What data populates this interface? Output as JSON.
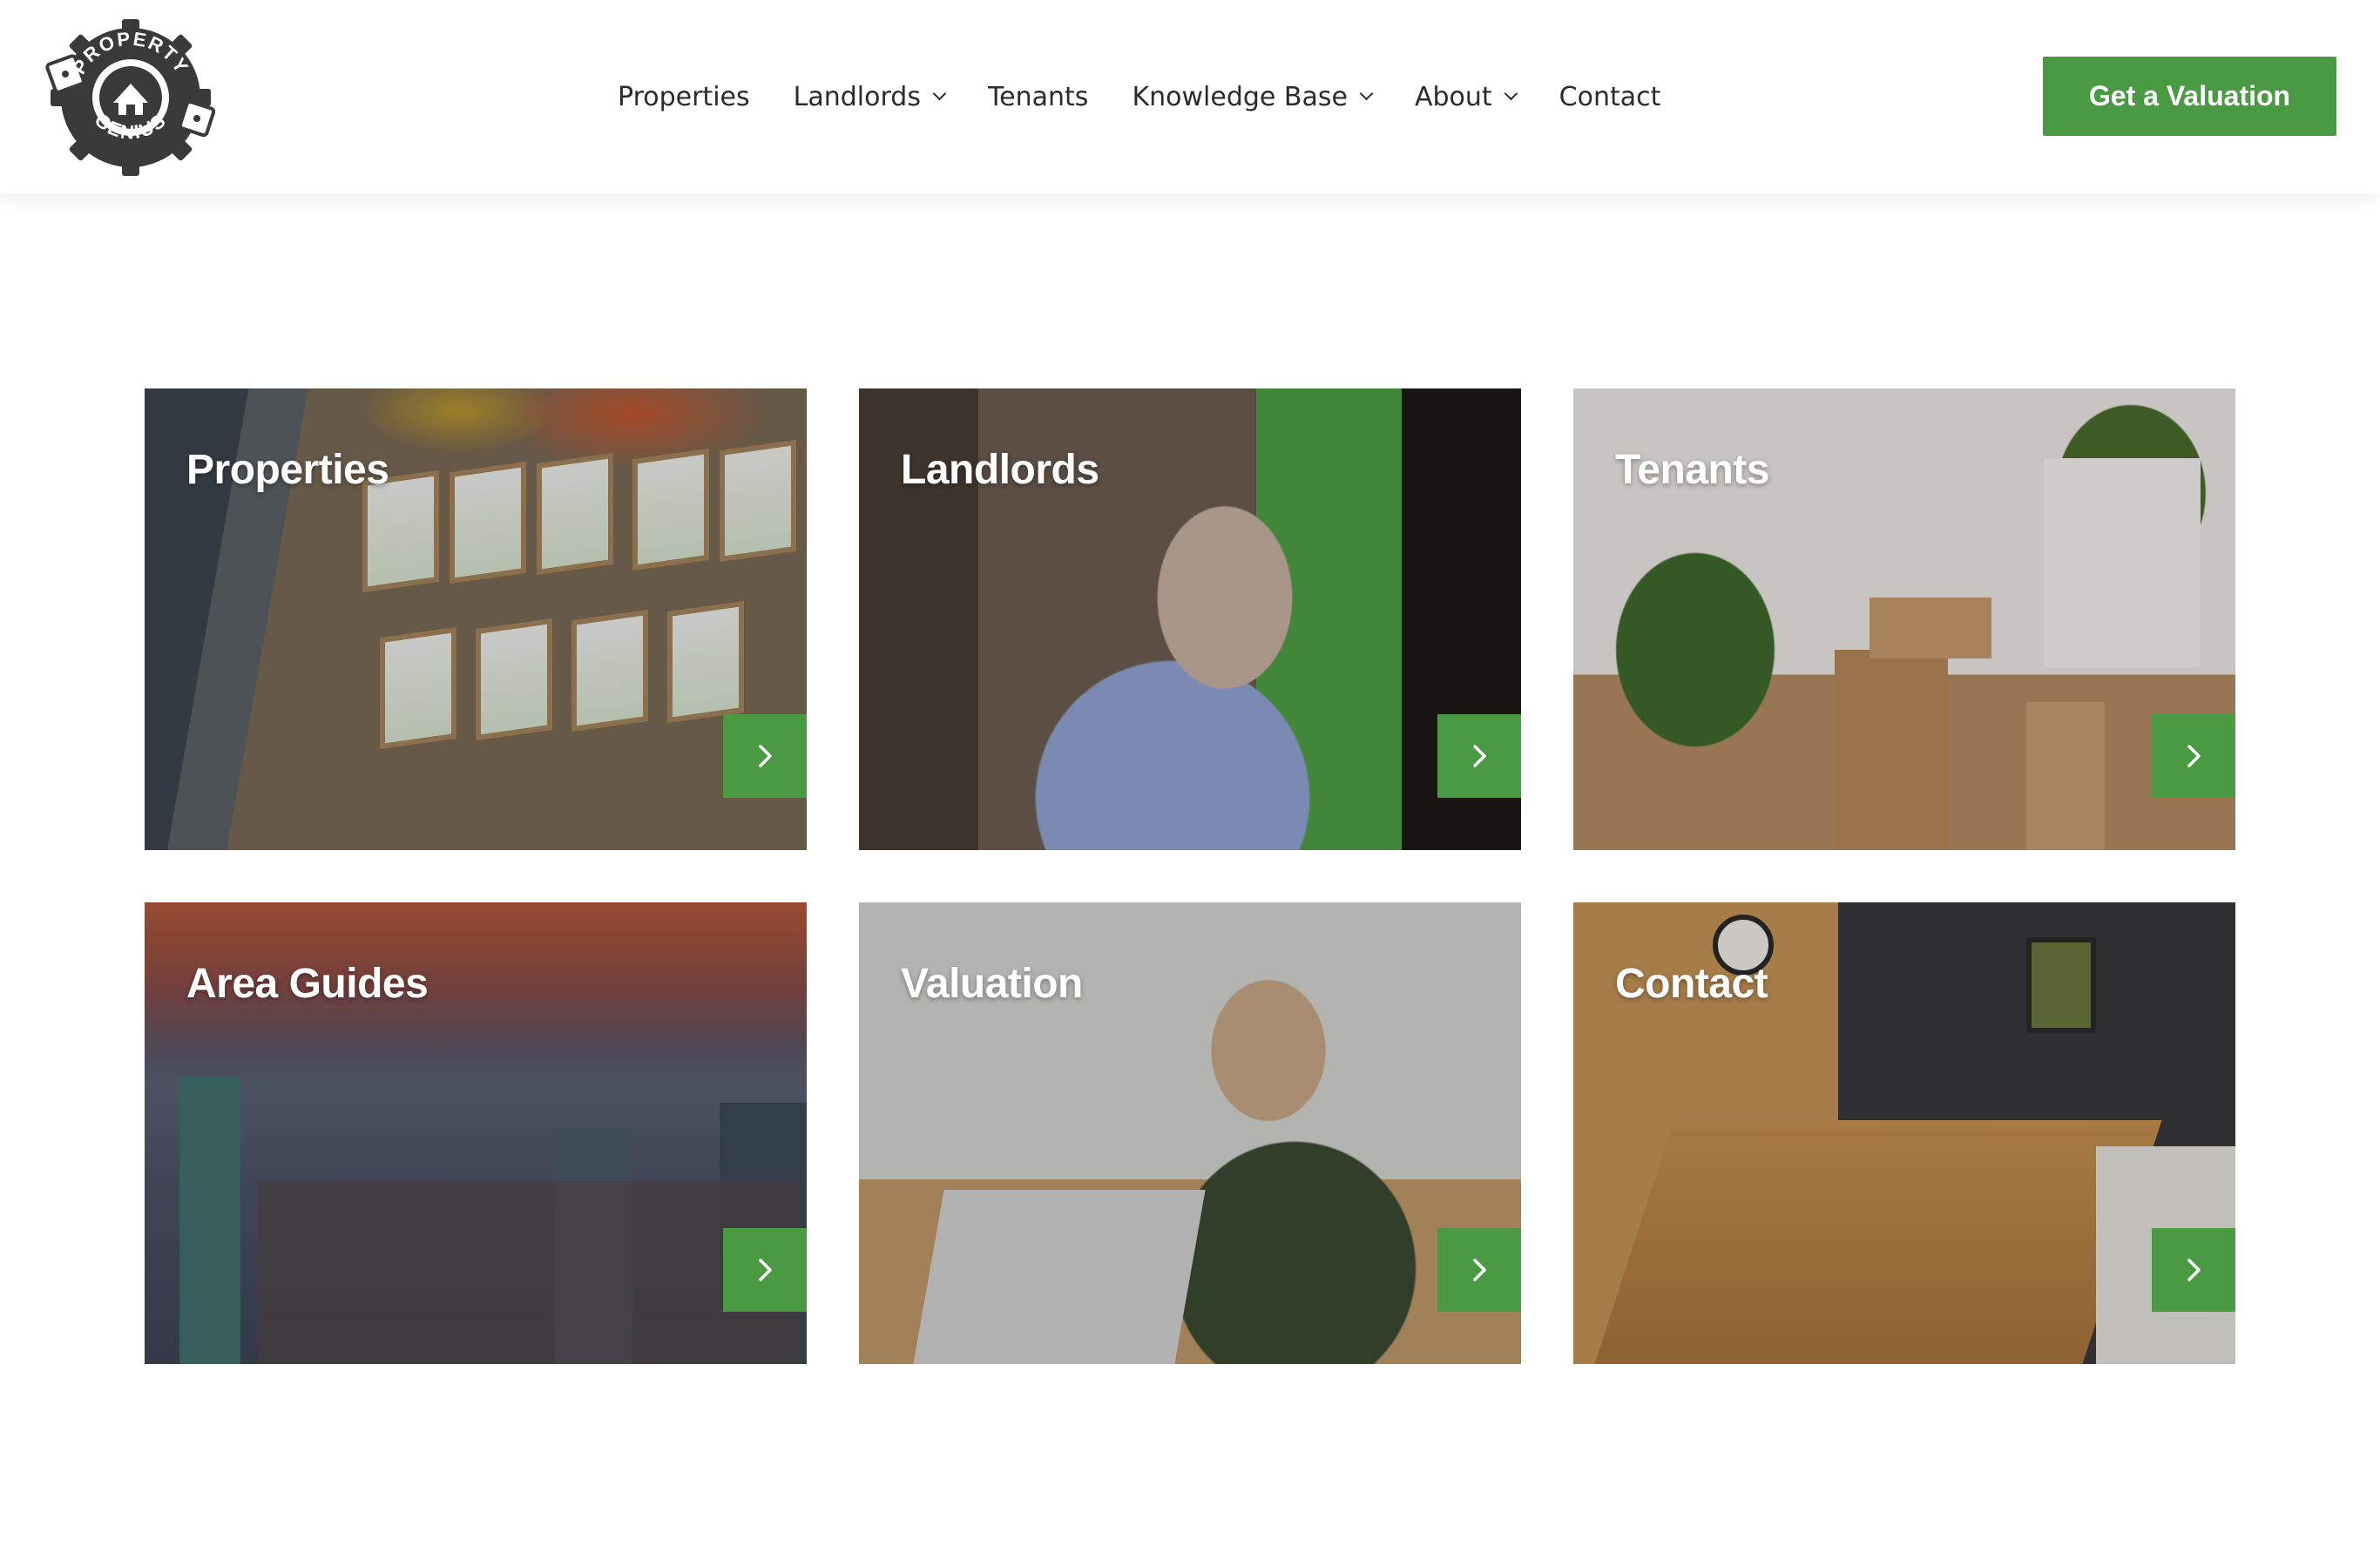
{
  "header": {
    "logo": {
      "text_top": "PROPERTY",
      "text_bottom": "GENIUS"
    },
    "nav": [
      {
        "label": "Properties",
        "has_dropdown": false
      },
      {
        "label": "Landlords",
        "has_dropdown": true
      },
      {
        "label": "Tenants",
        "has_dropdown": false
      },
      {
        "label": "Knowledge Base",
        "has_dropdown": true
      },
      {
        "label": "About",
        "has_dropdown": true
      },
      {
        "label": "Contact",
        "has_dropdown": false
      }
    ],
    "cta_label": "Get a Valuation"
  },
  "cards": [
    {
      "title": "Properties",
      "arrow_icon": "chevron-right-icon"
    },
    {
      "title": "Landlords",
      "arrow_icon": "chevron-right-icon"
    },
    {
      "title": "Tenants",
      "arrow_icon": "chevron-right-icon"
    },
    {
      "title": "Area Guides",
      "arrow_icon": "chevron-right-icon"
    },
    {
      "title": "Valuation",
      "arrow_icon": "chevron-right-icon"
    },
    {
      "title": "Contact",
      "arrow_icon": "chevron-right-icon"
    }
  ],
  "colors": {
    "brand_green": "#4a9a44",
    "header_bg": "#ffffff",
    "nav_text": "#2b2b2b",
    "card_title": "#ffffff"
  }
}
